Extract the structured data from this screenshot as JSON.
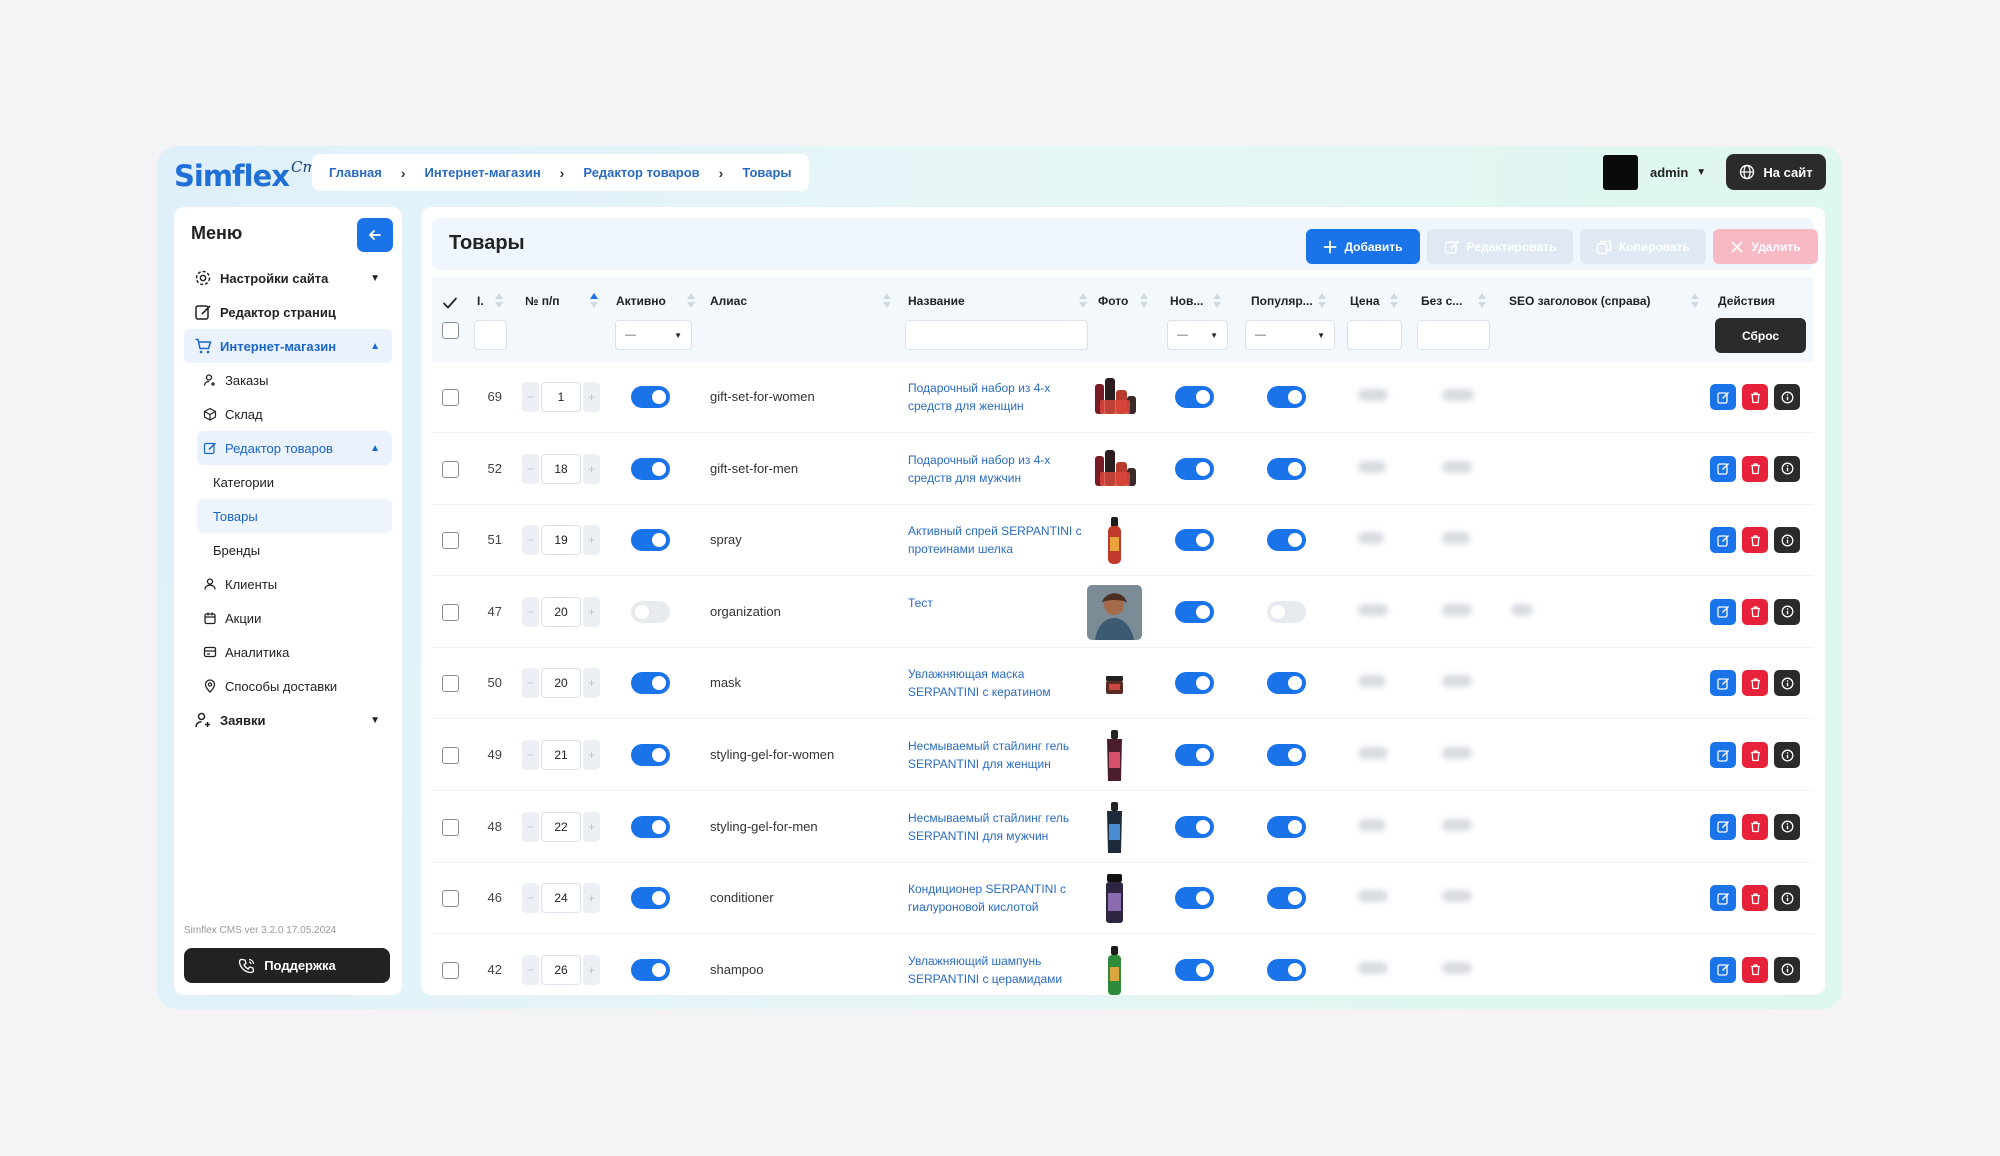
{
  "brand": {
    "name": "Simflex",
    "script": "Cms"
  },
  "breadcrumb": [
    "Главная",
    "Интернет-магазин",
    "Редактор товаров",
    "Товары"
  ],
  "user": {
    "name": "admin"
  },
  "site_button": "На сайт",
  "sidebar": {
    "title": "Меню",
    "items": [
      {
        "label": "Настройки сайта",
        "icon": "gear-icon",
        "chevron": "down"
      },
      {
        "label": "Редактор страниц",
        "icon": "edit-page-icon"
      },
      {
        "label": "Интернет-магазин",
        "icon": "cart-icon",
        "chevron": "up",
        "active": true
      },
      {
        "label": "Заказы",
        "icon": "user-orders-icon"
      },
      {
        "label": "Склад",
        "icon": "box-icon"
      },
      {
        "label": "Редактор товаров",
        "icon": "edit-icon",
        "chevron": "up",
        "active": true
      },
      {
        "label": "Категории"
      },
      {
        "label": "Товары",
        "active": true
      },
      {
        "label": "Бренды"
      },
      {
        "label": "Клиенты",
        "icon": "clients-icon"
      },
      {
        "label": "Акции",
        "icon": "calendar-icon"
      },
      {
        "label": "Аналитика",
        "icon": "analytics-icon"
      },
      {
        "label": "Способы доставки",
        "icon": "location-icon"
      },
      {
        "label": "Заявки",
        "icon": "requests-icon",
        "chevron": "down"
      }
    ],
    "version": "Simflex CMS ver 3.2.0 17.05.2024",
    "support": "Поддержка"
  },
  "page": {
    "title": "Товары",
    "buttons": {
      "add": "Добавить",
      "edit": "Редактировать",
      "copy": "Копировать",
      "delete": "Удалить"
    }
  },
  "table": {
    "columns": {
      "id": "I.",
      "order": "№ п/п",
      "active": "Активно",
      "alias": "Алиас",
      "name": "Название",
      "photo": "Фото",
      "new": "Нов...",
      "popular": "Популяр...",
      "price": "Цена",
      "no_discount": "Без с...",
      "seo": "SEO заголовок (справа)",
      "actions": "Действия"
    },
    "filters": {
      "active": "—",
      "new": "—",
      "popular": "—"
    },
    "reset": "Сброс",
    "rows": [
      {
        "id": "69",
        "order": "1",
        "active": true,
        "alias": "gift-set-for-women",
        "name": "Подарочный набор из 4-х средств для женщин",
        "new": true,
        "popular": true
      },
      {
        "id": "52",
        "order": "18",
        "active": true,
        "alias": "gift-set-for-men",
        "name": "Подарочный набор из 4-х средств для мужчин",
        "new": true,
        "popular": true
      },
      {
        "id": "51",
        "order": "19",
        "active": true,
        "alias": "spray",
        "name": "Активный спрей SERPANTINI с протеинами шелка",
        "new": true,
        "popular": true
      },
      {
        "id": "47",
        "order": "20",
        "active": false,
        "alias": "organization",
        "name": "Тест",
        "new": true,
        "popular": false
      },
      {
        "id": "50",
        "order": "20",
        "active": true,
        "alias": "mask",
        "name": "Увлажняющая маска SERPANTINI с кератином",
        "new": true,
        "popular": true
      },
      {
        "id": "49",
        "order": "21",
        "active": true,
        "alias": "styling-gel-for-women",
        "name": "Несмываемый стайлинг гель SERPANTINI для женщин",
        "new": true,
        "popular": true
      },
      {
        "id": "48",
        "order": "22",
        "active": true,
        "alias": "styling-gel-for-men",
        "name": "Несмываемый стайлинг гель SERPANTINI для мужчин",
        "new": true,
        "popular": true
      },
      {
        "id": "46",
        "order": "24",
        "active": true,
        "alias": "conditioner",
        "name": "Кондиционер SERPANTINI с гиалуроновой кислотой",
        "new": true,
        "popular": true
      },
      {
        "id": "42",
        "order": "26",
        "active": true,
        "alias": "shampoo",
        "name": "Увлажняющий шампунь SERPANTINI с церамидами",
        "new": true,
        "popular": true
      }
    ]
  },
  "colors": {
    "accent": "#1a73e8",
    "danger": "#e8213b",
    "dark": "#2b2b2b"
  }
}
